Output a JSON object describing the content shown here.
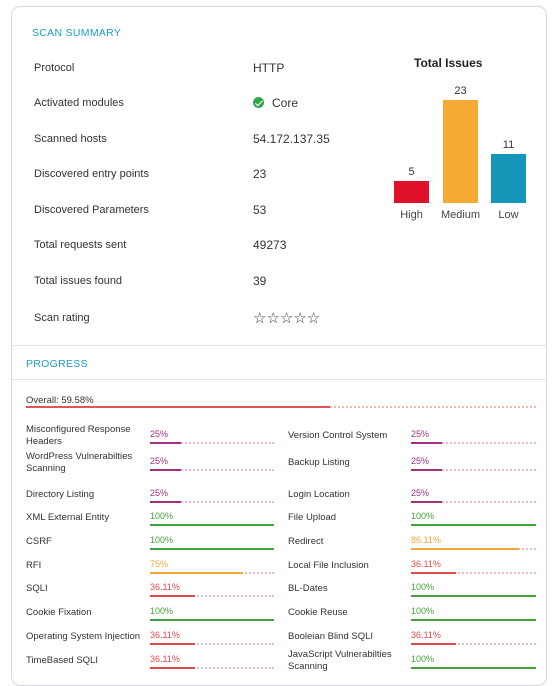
{
  "summary": {
    "title": "SCAN SUMMARY",
    "rows": [
      {
        "label": "Protocol",
        "value": "HTTP"
      },
      {
        "label": "Activated modules",
        "value": "Core",
        "icon": "check-circle-icon"
      },
      {
        "label": "Scanned hosts",
        "value": "54.172.137.35"
      },
      {
        "label": "Discovered entry points",
        "value": "23"
      },
      {
        "label": "Discovered Parameters",
        "value": "53"
      },
      {
        "label": "Total requests sent",
        "value": "49273"
      },
      {
        "label": "Total issues found",
        "value": "39"
      },
      {
        "label": "Scan rating",
        "stars_filled": 0,
        "stars_total": 5,
        "icon": "star-outline-icon"
      }
    ]
  },
  "chart_data": {
    "type": "bar",
    "title": "Total Issues",
    "categories": [
      "High",
      "Medium",
      "Low"
    ],
    "values": [
      5,
      23,
      11
    ],
    "colors": [
      "#e0102b",
      "#f7a935",
      "#1496b8"
    ],
    "grid": false,
    "legend": "none"
  },
  "progress": {
    "title": "PROGRESS",
    "overall_label": "Overall: 59.58%",
    "overall_value": 59.58,
    "overall_color": "#e05555",
    "colors": {
      "done": "#44a33d",
      "low": "#a3307e",
      "mid": "#e14b4b",
      "warn": "#f0a83a",
      "high": "#f0a83a"
    },
    "left": [
      {
        "name": "Misconfigured Response Headers",
        "pct": "25%",
        "value": 25,
        "color": "#a3307e"
      },
      {
        "name": "WordPress Vulnerabilties Scanning",
        "pct": "25%",
        "value": 25,
        "color": "#a3307e"
      },
      {
        "name": "Directory Listing",
        "pct": "25%",
        "value": 25,
        "color": "#a3307e"
      },
      {
        "name": "XML External Entity",
        "pct": "100%",
        "value": 100,
        "color": "#44a33d"
      },
      {
        "name": "CSRF",
        "pct": "100%",
        "value": 100,
        "color": "#44a33d"
      },
      {
        "name": "RFI",
        "pct": "75%",
        "value": 75,
        "color": "#f0a83a"
      },
      {
        "name": "SQLI",
        "pct": "36.11%",
        "value": 36.11,
        "color": "#e14b4b"
      },
      {
        "name": "Cookie Fixation",
        "pct": "100%",
        "value": 100,
        "color": "#44a33d"
      },
      {
        "name": "Operating System Injection",
        "pct": "36.11%",
        "value": 36.11,
        "color": "#e14b4b"
      },
      {
        "name": "TimeBased SQLI",
        "pct": "36.11%",
        "value": 36.11,
        "color": "#e14b4b"
      }
    ],
    "right": [
      {
        "name": "Version Control System",
        "pct": "25%",
        "value": 25,
        "color": "#a3307e"
      },
      {
        "name": "Backup Listing",
        "pct": "25%",
        "value": 25,
        "color": "#a3307e"
      },
      {
        "name": "Login Location",
        "pct": "25%",
        "value": 25,
        "color": "#a3307e"
      },
      {
        "name": "File Upload",
        "pct": "100%",
        "value": 100,
        "color": "#44a33d"
      },
      {
        "name": "Redirect",
        "pct": "86.11%",
        "value": 86.11,
        "color": "#f0a83a"
      },
      {
        "name": "Local File Inclusion",
        "pct": "36.11%",
        "value": 36.11,
        "color": "#e14b4b"
      },
      {
        "name": "BL-Dates",
        "pct": "100%",
        "value": 100,
        "color": "#44a33d"
      },
      {
        "name": "Cookie Reuse",
        "pct": "100%",
        "value": 100,
        "color": "#44a33d"
      },
      {
        "name": "Booleian Blind SQLI",
        "pct": "36.11%",
        "value": 36.11,
        "color": "#e14b4b"
      },
      {
        "name": "JavaScript Vulnerabilties Scanning",
        "pct": "100%",
        "value": 100,
        "color": "#44a33d"
      }
    ]
  }
}
